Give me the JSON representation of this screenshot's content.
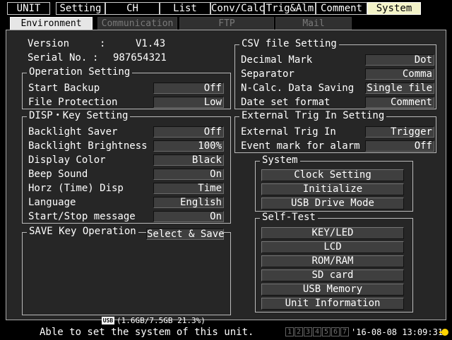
{
  "top_tabs": [
    {
      "label": "UNIT",
      "active": false
    },
    {
      "label": "Setting",
      "active": false
    },
    {
      "label": "CH",
      "active": false
    },
    {
      "label": "List",
      "active": false
    },
    {
      "label": "Conv/Calc",
      "active": false
    },
    {
      "label": "Trig&Alm",
      "active": false
    },
    {
      "label": "Comment",
      "active": false
    },
    {
      "label": "System",
      "active": true
    }
  ],
  "sub_tabs": [
    {
      "label": "Environment",
      "active": true
    },
    {
      "label": "Communication",
      "active": false
    },
    {
      "label": "FTP",
      "active": false
    },
    {
      "label": "Mail",
      "active": false
    }
  ],
  "info": {
    "version_label": "Version",
    "version_sep": ":",
    "version_value": "V1.43",
    "serial_label": "Serial No.",
    "serial_sep": ":",
    "serial_value": "987654321"
  },
  "operation": {
    "title": "Operation Setting",
    "rows": [
      {
        "label": "Start Backup",
        "value": "Off"
      },
      {
        "label": "File Protection",
        "value": "Low"
      }
    ]
  },
  "disp_key": {
    "title": "DISP・Key Setting",
    "rows": [
      {
        "label": "Backlight Saver",
        "value": "Off"
      },
      {
        "label": "Backlight Brightness",
        "value": "100%"
      },
      {
        "label": "Display Color",
        "value": "Black"
      },
      {
        "label": "Beep Sound",
        "value": "On"
      },
      {
        "label": "Horz (Time) Disp",
        "value": "Time"
      },
      {
        "label": "Language",
        "value": "English"
      },
      {
        "label": "Start/Stop message",
        "value": "On"
      }
    ]
  },
  "save_key": {
    "title": "SAVE Key Operation",
    "value": "Select & Save"
  },
  "csv": {
    "title": "CSV file Setting",
    "rows": [
      {
        "label": "Decimal Mark",
        "value": "Dot"
      },
      {
        "label": "Separator",
        "value": "Comma"
      },
      {
        "label": "N-Calc. Data Saving",
        "value": "Single file"
      },
      {
        "label": "Date set format",
        "value": "Comment"
      }
    ]
  },
  "ext_trig": {
    "title": "External Trig In Setting",
    "rows": [
      {
        "label": "External Trig In",
        "value": "Trigger"
      },
      {
        "label": "Event mark for alarm",
        "value": "Off"
      }
    ]
  },
  "system": {
    "title": "System",
    "buttons": [
      "Clock Setting",
      "Initialize",
      "USB Drive Mode"
    ]
  },
  "self_test": {
    "title": "Self-Test",
    "buttons": [
      "KEY/LED",
      "LCD",
      "ROM/RAM",
      "SD card",
      "USB Memory",
      "Unit Information"
    ]
  },
  "status": {
    "usb_icon_text": "USB",
    "usb_capacity": "(1.6GB/7.5GB 21.3%)",
    "message": "Able to set the system of this unit.",
    "channels": [
      "1",
      "2",
      "3",
      "4",
      "5",
      "6",
      "7"
    ],
    "datetime": "'16-08-08 13:09:31"
  },
  "colors": {
    "active_tab": "#f3f3c8",
    "panel": "#262626",
    "value_box": "#3f3f3f",
    "indicator": "#ffd400"
  }
}
